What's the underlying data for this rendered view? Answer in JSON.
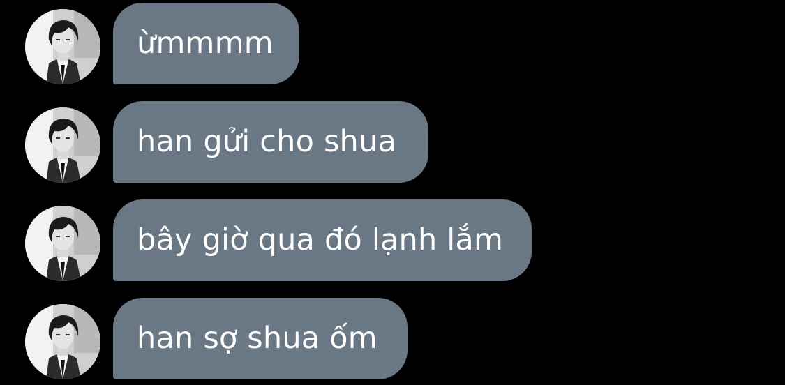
{
  "colors": {
    "background": "#000000",
    "bubble": "#6a7784",
    "bubble_text": "#ffffff"
  },
  "messages": [
    {
      "text": "ừmmmm",
      "avatar_icon": "profile-photo"
    },
    {
      "text": "han gửi cho shua",
      "avatar_icon": "profile-photo"
    },
    {
      "text": "bây giờ qua đó lạnh lắm",
      "avatar_icon": "profile-photo"
    },
    {
      "text": "han sợ shua ốm",
      "avatar_icon": "profile-photo"
    }
  ]
}
